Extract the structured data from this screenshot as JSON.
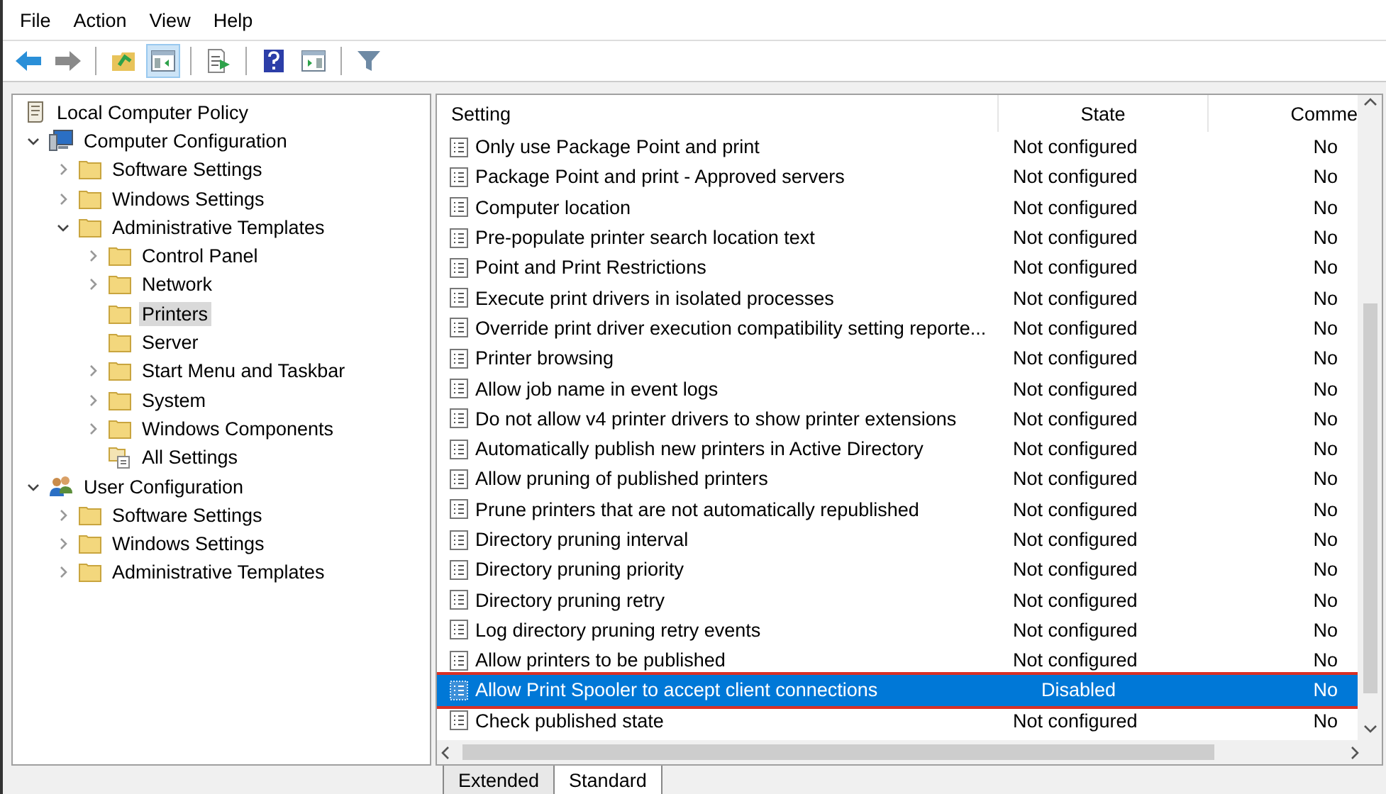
{
  "menu": [
    "File",
    "Action",
    "View",
    "Help"
  ],
  "toolbar": [
    [
      {
        "kind": "back",
        "selected": false
      },
      {
        "kind": "forward",
        "selected": false
      }
    ],
    [
      {
        "kind": "up",
        "selected": false
      },
      {
        "kind": "tree",
        "selected": true
      }
    ],
    [
      {
        "kind": "export",
        "selected": false
      }
    ],
    [
      {
        "kind": "help",
        "selected": false
      },
      {
        "kind": "pane",
        "selected": false
      }
    ],
    [
      {
        "kind": "filter",
        "selected": false
      }
    ]
  ],
  "tree": [
    {
      "label": "Local Computer Policy",
      "kind": "policy",
      "selected": false,
      "children": [
        {
          "label": "Computer Configuration",
          "kind": "computer",
          "expanded": true,
          "selected": false,
          "children": [
            {
              "label": "Software Settings",
              "kind": "folder",
              "expanded": false,
              "selected": false
            },
            {
              "label": "Windows Settings",
              "kind": "folder",
              "expanded": false,
              "selected": false
            },
            {
              "label": "Administrative Templates",
              "kind": "folder",
              "expanded": true,
              "selected": false,
              "children": [
                {
                  "label": "Control Panel",
                  "kind": "folder",
                  "expanded": false,
                  "selected": false
                },
                {
                  "label": "Network",
                  "kind": "folder",
                  "expanded": false,
                  "selected": false
                },
                {
                  "label": "Printers",
                  "kind": "folder",
                  "selected": true
                },
                {
                  "label": "Server",
                  "kind": "folder",
                  "selected": false
                },
                {
                  "label": "Start Menu and Taskbar",
                  "kind": "folder",
                  "expanded": false,
                  "selected": false
                },
                {
                  "label": "System",
                  "kind": "folder",
                  "expanded": false,
                  "selected": false
                },
                {
                  "label": "Windows Components",
                  "kind": "folder",
                  "expanded": false,
                  "selected": false
                },
                {
                  "label": "All Settings",
                  "kind": "all-settings",
                  "selected": false
                }
              ]
            }
          ]
        },
        {
          "label": "User Configuration",
          "kind": "user",
          "expanded": true,
          "selected": false,
          "children": [
            {
              "label": "Software Settings",
              "kind": "folder",
              "expanded": false,
              "selected": false
            },
            {
              "label": "Windows Settings",
              "kind": "folder",
              "expanded": false,
              "selected": false
            },
            {
              "label": "Administrative Templates",
              "kind": "folder",
              "expanded": false,
              "selected": false
            }
          ]
        }
      ]
    }
  ],
  "table": {
    "columns": [
      "Setting",
      "State",
      "Comme"
    ],
    "rows": [
      {
        "setting": "Only use Package Point and print",
        "state": "Not configured",
        "comment": "No",
        "selected": false,
        "highlighted": false
      },
      {
        "setting": "Package Point and print - Approved servers",
        "state": "Not configured",
        "comment": "No",
        "selected": false,
        "highlighted": false
      },
      {
        "setting": "Computer location",
        "state": "Not configured",
        "comment": "No",
        "selected": false,
        "highlighted": false
      },
      {
        "setting": "Pre-populate printer search location text",
        "state": "Not configured",
        "comment": "No",
        "selected": false,
        "highlighted": false
      },
      {
        "setting": "Point and Print Restrictions",
        "state": "Not configured",
        "comment": "No",
        "selected": false,
        "highlighted": false
      },
      {
        "setting": "Execute print drivers in isolated processes",
        "state": "Not configured",
        "comment": "No",
        "selected": false,
        "highlighted": false
      },
      {
        "setting": "Override print driver execution compatibility setting reporte...",
        "state": "Not configured",
        "comment": "No",
        "selected": false,
        "highlighted": false
      },
      {
        "setting": "Printer browsing",
        "state": "Not configured",
        "comment": "No",
        "selected": false,
        "highlighted": false
      },
      {
        "setting": "Allow job name in event logs",
        "state": "Not configured",
        "comment": "No",
        "selected": false,
        "highlighted": false
      },
      {
        "setting": "Do not allow v4 printer drivers to show printer extensions",
        "state": "Not configured",
        "comment": "No",
        "selected": false,
        "highlighted": false
      },
      {
        "setting": "Automatically publish new printers in Active Directory",
        "state": "Not configured",
        "comment": "No",
        "selected": false,
        "highlighted": false
      },
      {
        "setting": "Allow pruning of published printers",
        "state": "Not configured",
        "comment": "No",
        "selected": false,
        "highlighted": false
      },
      {
        "setting": "Prune printers that are not automatically republished",
        "state": "Not configured",
        "comment": "No",
        "selected": false,
        "highlighted": false
      },
      {
        "setting": "Directory pruning interval",
        "state": "Not configured",
        "comment": "No",
        "selected": false,
        "highlighted": false
      },
      {
        "setting": "Directory pruning priority",
        "state": "Not configured",
        "comment": "No",
        "selected": false,
        "highlighted": false
      },
      {
        "setting": "Directory pruning retry",
        "state": "Not configured",
        "comment": "No",
        "selected": false,
        "highlighted": false
      },
      {
        "setting": "Log directory pruning retry events",
        "state": "Not configured",
        "comment": "No",
        "selected": false,
        "highlighted": false
      },
      {
        "setting": "Allow printers to be published",
        "state": "Not configured",
        "comment": "No",
        "selected": false,
        "highlighted": false
      },
      {
        "setting": "Allow Print Spooler to accept client connections",
        "state": "Disabled",
        "comment": "No",
        "selected": true,
        "highlighted": true
      },
      {
        "setting": "Check published state",
        "state": "Not configured",
        "comment": "No",
        "selected": false,
        "highlighted": false
      }
    ]
  },
  "tabs": [
    {
      "label": "Extended",
      "selected": false
    },
    {
      "label": "Standard",
      "selected": true
    }
  ]
}
